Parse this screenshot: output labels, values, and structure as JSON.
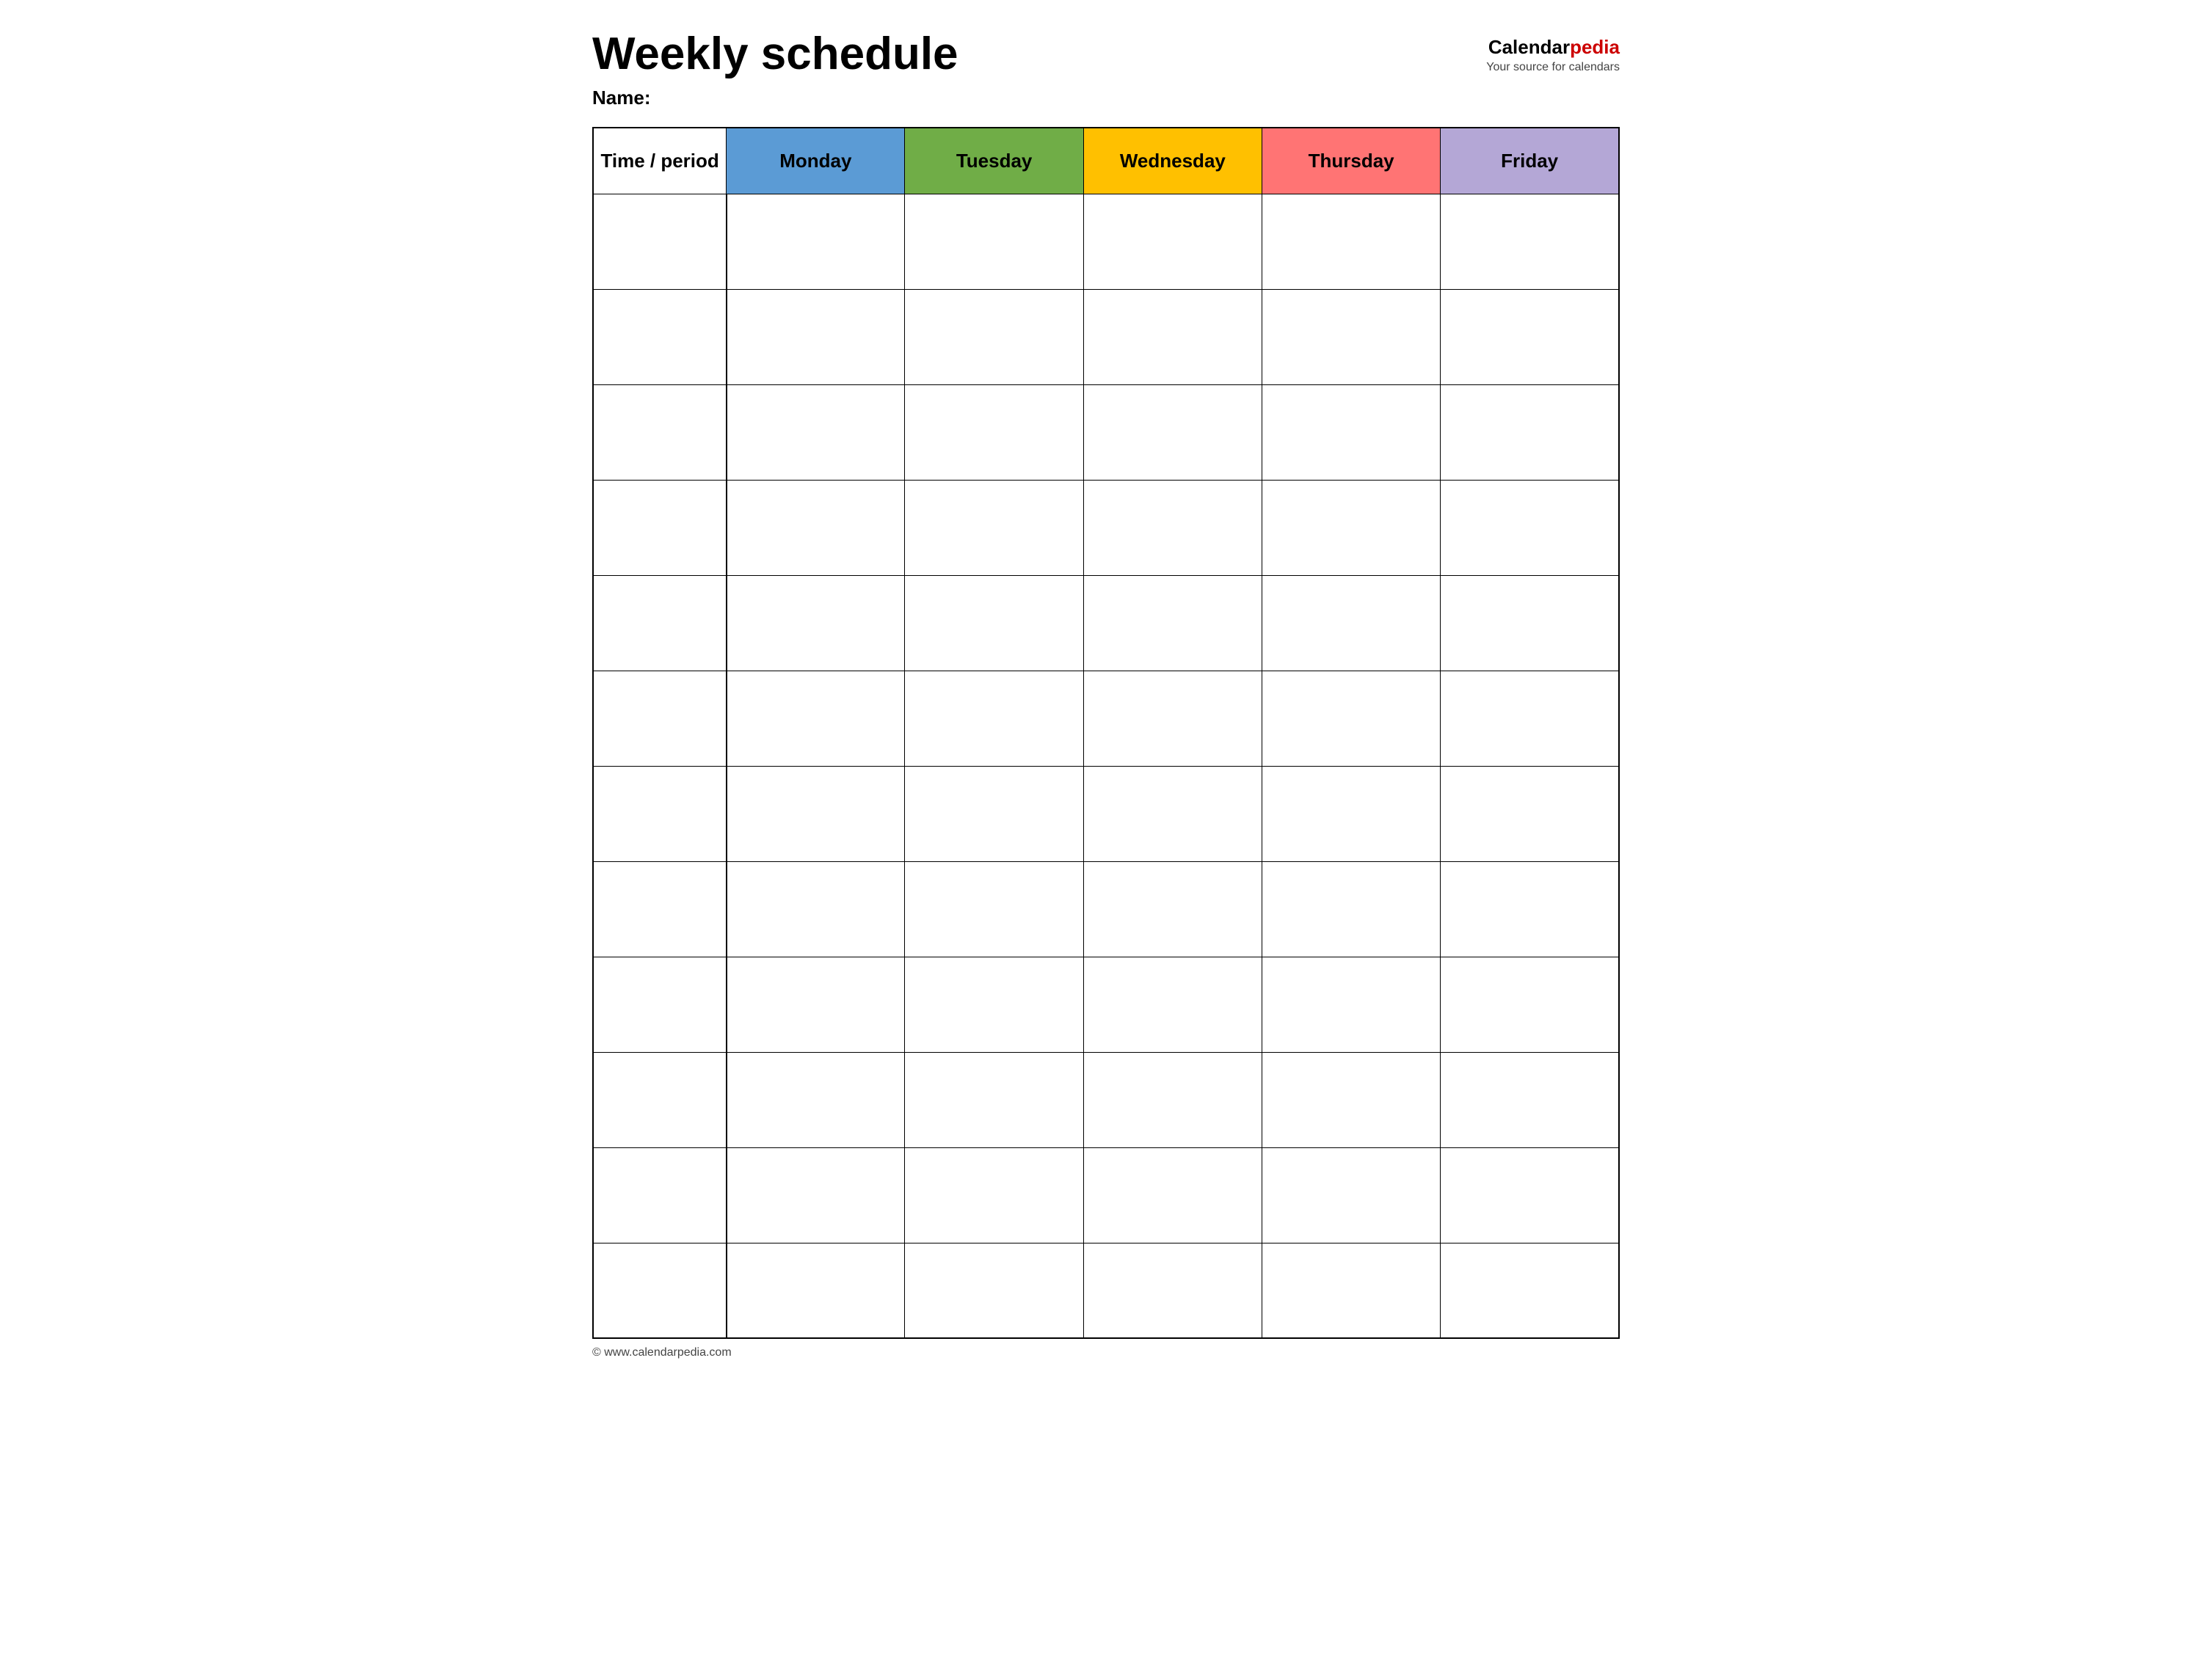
{
  "header": {
    "title": "Weekly schedule",
    "logo_calendar": "Calendar",
    "logo_pedia": "pedia",
    "logo_tagline": "Your source for calendars",
    "name_label": "Name:"
  },
  "table": {
    "columns": [
      {
        "key": "time",
        "label": "Time / period",
        "class": "col-time"
      },
      {
        "key": "monday",
        "label": "Monday",
        "class": "col-monday"
      },
      {
        "key": "tuesday",
        "label": "Tuesday",
        "class": "col-tuesday"
      },
      {
        "key": "wednesday",
        "label": "Wednesday",
        "class": "col-wednesday"
      },
      {
        "key": "thursday",
        "label": "Thursday",
        "class": "col-thursday"
      },
      {
        "key": "friday",
        "label": "Friday",
        "class": "col-friday"
      }
    ],
    "row_count": 12
  },
  "footer": {
    "text": "© www.calendarpedia.com"
  }
}
